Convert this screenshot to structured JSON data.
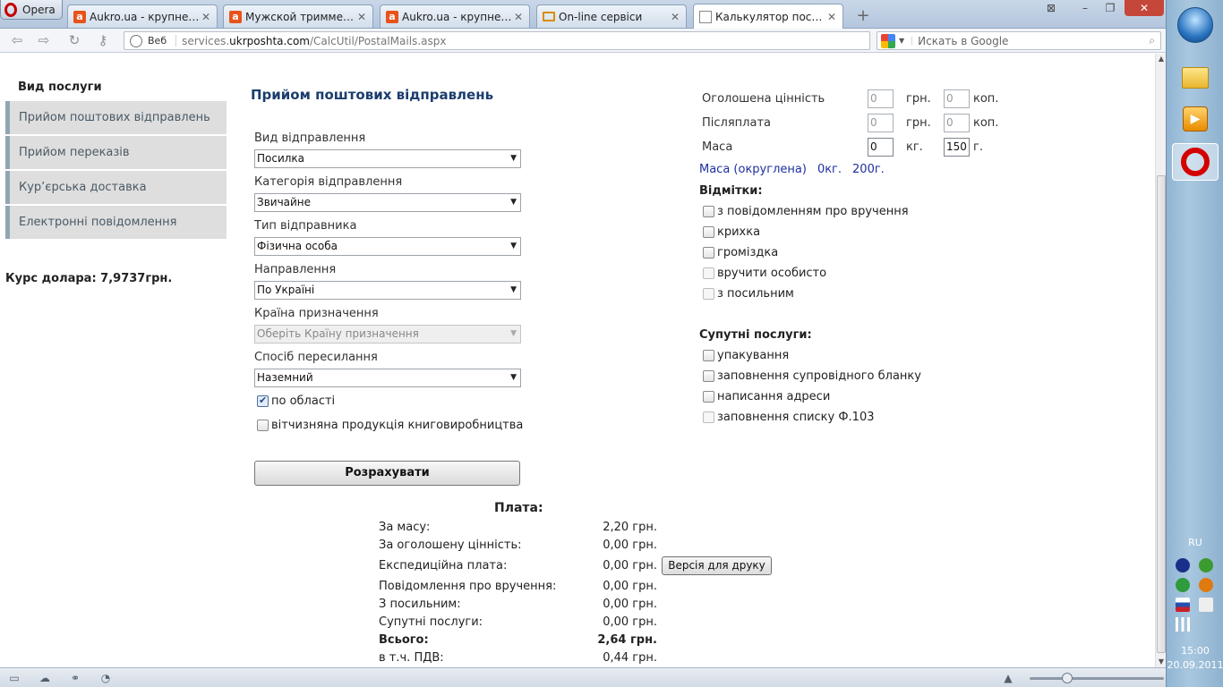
{
  "browser": {
    "menu_label": "Opera",
    "tabs": [
      {
        "title": "Aukro.ua - крупнейши...",
        "icon": "aukro-icon"
      },
      {
        "title": "Мужской триммер (г...",
        "icon": "aukro-icon"
      },
      {
        "title": "Aukro.ua - крупнейши...",
        "icon": "aukro-icon"
      },
      {
        "title": "On-line сервіси",
        "icon": "mail-icon"
      },
      {
        "title": "Калькулятор послуг",
        "icon": "page-icon"
      }
    ],
    "web_label": "Веб",
    "url_prefix": "services.",
    "url_domain": "ukrposhta.com",
    "url_path": "/CalcUtil/PostalMails.aspx",
    "search_placeholder": "Искать в Google"
  },
  "sidebar": {
    "header": "Вид послуги",
    "items": [
      {
        "label": "Прийом поштових відправлень"
      },
      {
        "label": "Прийом переказів"
      },
      {
        "label": "Кур’єрська доставка"
      },
      {
        "label": "Електронні повідомлення"
      }
    ],
    "rate": "Курс долара: 7,9737грн."
  },
  "form": {
    "title": "Прийом поштових відправлень",
    "fields": [
      {
        "label": "Вид відправлення",
        "value": "Посилка"
      },
      {
        "label": "Категорія відправлення",
        "value": "Звичайне"
      },
      {
        "label": "Тип відправника",
        "value": "Фізична особа"
      },
      {
        "label": "Направлення",
        "value": "По Україні"
      },
      {
        "label": "Країна призначення",
        "value": "Оберіть Країну призначення"
      },
      {
        "label": "Спосіб пересилання",
        "value": "Наземний"
      }
    ],
    "checkbox_region": "по області",
    "checkbox_region_checked": true,
    "checkbox_books": "вітчизняна продукція книговиробництва",
    "calc_button": "Розрахувати"
  },
  "params": {
    "declared_value": {
      "label": "Оголошена цінність",
      "uah": "0",
      "kop": "0"
    },
    "cod": {
      "label": "Післяплата",
      "uah": "0",
      "kop": "0"
    },
    "mass": {
      "label": "Маса",
      "kg": "0",
      "g": "150"
    },
    "unit_uah": "грн.",
    "unit_kop": "коп.",
    "unit_kg": "кг.",
    "unit_g": "г.",
    "rounded_label": "Маса (округлена)",
    "rounded_kg": "0кг.",
    "rounded_g": "200г."
  },
  "marks": {
    "header": "Відмітки:",
    "items": [
      "з повідомленням про вручення",
      "крихка",
      "громіздка",
      "вручити особисто",
      "з посильним"
    ]
  },
  "services": {
    "header": "Супутні послуги:",
    "items": [
      "упакування",
      "заповнення супровідного бланку",
      "написання адреси",
      "заповнення списку Ф.103"
    ]
  },
  "payment": {
    "header": "Плата:",
    "rows": [
      {
        "label": "За масу:",
        "value": "2,20 грн."
      },
      {
        "label": "За оголошену цінність:",
        "value": "0,00 грн."
      },
      {
        "label": "Експедиційна плата:",
        "value": "0,00 грн."
      },
      {
        "label": "Повідомлення про вручення:",
        "value": "0,00 грн."
      },
      {
        "label": "З посильним:",
        "value": "0,00 грн."
      },
      {
        "label": "Супутні послуги:",
        "value": "0,00 грн."
      },
      {
        "label": "Всього:",
        "value": "2,64 грн."
      },
      {
        "label": "в т.ч. ПДВ:",
        "value": "0,44 грн."
      }
    ],
    "print_button": "Версія для друку"
  },
  "taskbar": {
    "language": "RU",
    "time": "15:00",
    "date": "20.09.2011"
  }
}
